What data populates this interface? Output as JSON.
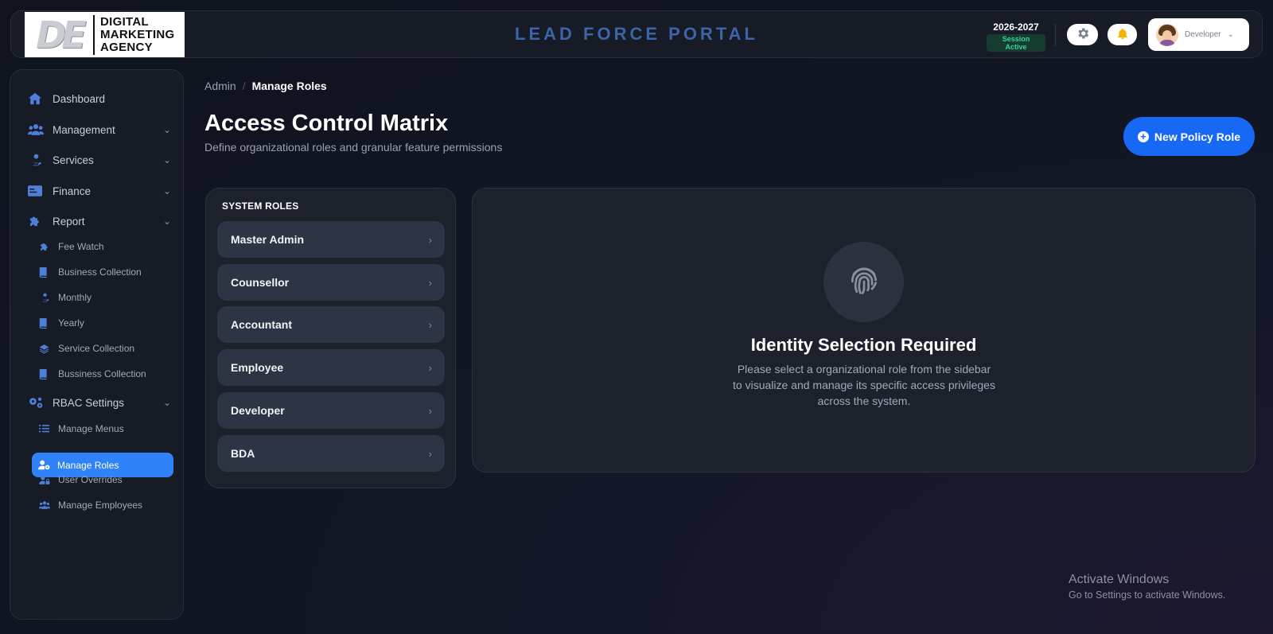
{
  "header": {
    "logo": {
      "mark": "DE",
      "lines": [
        "DIGITAL",
        "MARKETING",
        "AGENCY"
      ]
    },
    "portal_title": "LEAD FORCE PORTAL",
    "session_year": "2026-2027",
    "session_status": "Session Active",
    "user_name": "Developer"
  },
  "sidebar": {
    "items": [
      {
        "label": "Dashboard",
        "icon": "home-icon"
      },
      {
        "label": "Management",
        "icon": "users-icon"
      },
      {
        "label": "Services",
        "icon": "hand-coin-icon"
      },
      {
        "label": "Finance",
        "icon": "card-icon"
      },
      {
        "label": "Report",
        "icon": "puzzle-icon"
      }
    ],
    "report_sub": [
      {
        "label": "Fee Watch",
        "icon": "puzzle-icon"
      },
      {
        "label": "Business Collection",
        "icon": "book-icon"
      },
      {
        "label": "Monthly",
        "icon": "hand-coin-icon"
      },
      {
        "label": "Yearly",
        "icon": "book-icon"
      },
      {
        "label": "Service Collection",
        "icon": "layers-icon"
      },
      {
        "label": "Bussiness Collection",
        "icon": "book-icon"
      }
    ],
    "rbac": {
      "label": "RBAC Settings",
      "icon": "gears-icon"
    },
    "rbac_sub": [
      {
        "label": "Manage Menus",
        "icon": "list-icon"
      },
      {
        "label": "Manage Roles",
        "icon": "user-cog-icon",
        "active": true
      },
      {
        "label": "User Overrides",
        "icon": "user-lock-icon"
      },
      {
        "label": "Manage Employees",
        "icon": "users-icon"
      }
    ]
  },
  "breadcrumb": {
    "root": "Admin",
    "separator": "/",
    "current": "Manage Roles"
  },
  "page": {
    "title": "Access Control Matrix",
    "subtitle": "Define organizational roles and granular feature permissions",
    "new_role_button": "New Policy Role"
  },
  "roles": {
    "heading": "SYSTEM ROLES",
    "items": [
      "Master Admin",
      "Counsellor",
      "Accountant",
      "Employee",
      "Developer",
      "BDA"
    ]
  },
  "empty_state": {
    "title": "Identity Selection Required",
    "line1": "Please select a organizational role from the sidebar",
    "line2": "to visualize and manage its specific access privileges",
    "line3": "across the system."
  },
  "watermark": {
    "title": "Activate Windows",
    "subtitle": "Go to Settings to activate Windows."
  },
  "colors": {
    "accent": "#2f82f7",
    "primary_button": "#1769f5",
    "session_green": "#34d399",
    "icon_blue": "#4f7fd9"
  }
}
